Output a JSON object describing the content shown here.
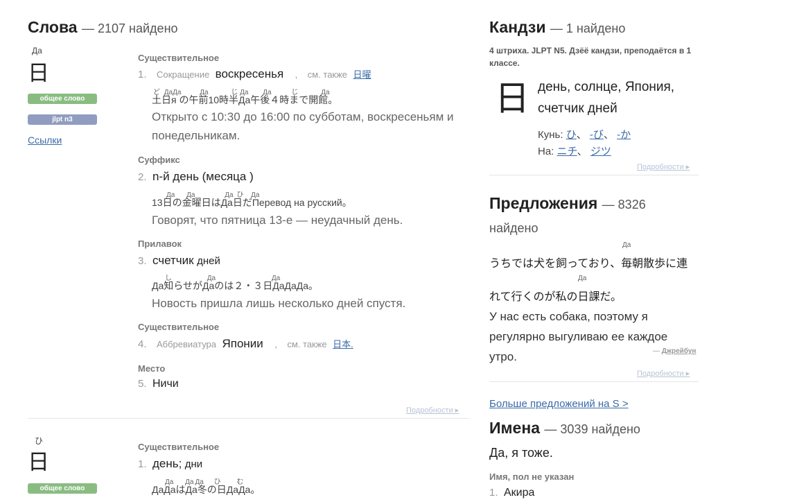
{
  "words": {
    "title": "Слова",
    "count": "— 2107 найдено",
    "entries": [
      {
        "reading": "Да",
        "kanji": "日",
        "tags": [
          "общее слово",
          "jlpt n3"
        ],
        "links_label": "Ссылки",
        "details_label": "Подробности ▸",
        "senses": [
          {
            "pos": "Существительное",
            "num": "1.",
            "prefix": "Сокращение",
            "meaning": "воскресенья",
            "comma": ",",
            "see_also": "см. также",
            "see_link": "日曜",
            "sentence_ja": "土日я の午前10時半Да午後４時まで開館。",
            "sentence_furi": [
              "ど",
              "Да",
              "Да",
              "Да",
              "じ",
              "Да",
              "Да",
              "じ",
              "Да"
            ],
            "sentence_en": "Открыто с 10:30 до 16:00 по субботам, воскресеньям и понедельникам."
          },
          {
            "pos": "Суффикс",
            "num": "2.",
            "meaning": "n-й день (месяца )",
            "sentence_ja": "13日の金曜日はДа日だПеревод на русский。",
            "sentence_furi": [
              "Да",
              "Да",
              "Да",
              "ひ",
              "Да"
            ],
            "sentence_en": "Говорят, что пятница 13-е — неудачный день."
          },
          {
            "pos": "Прилавок",
            "num": "3.",
            "meaning": "счетчик",
            "meaning_small": "дней",
            "sentence_ja": "Да知らせがДаのは２・３日ДаДаДа。",
            "sentence_furi": [
              "し",
              "Да",
              "Да"
            ],
            "sentence_en": "Новость пришла лишь несколько дней спустя."
          },
          {
            "pos": "Существительное",
            "num": "4.",
            "prefix": "Аббревиатура",
            "meaning": "Японии",
            "comma": ",",
            "see_also": "см. также",
            "see_link": "日本."
          },
          {
            "pos": "Место",
            "num": "5.",
            "meaning": "Ничи"
          }
        ]
      },
      {
        "reading": "ひ",
        "kanji": "日",
        "tags": [
          "общее слово"
        ],
        "senses": [
          {
            "pos": "Существительное",
            "num": "1.",
            "meaning": "день;",
            "meaning_small": "дни",
            "sentence_ja": "ДаДаはДа冬の日ДаДа。",
            "sentence_furi": [
              "Да",
              "Да",
              "Да",
              "ひ",
              "む"
            ]
          }
        ]
      }
    ]
  },
  "kanji": {
    "title": "Кандзи",
    "count": "— 1 найдено",
    "info": "4 штриха. JLPT N5. Дзёё кандзи, преподаётся в 1 классе.",
    "char": "日",
    "meaning": "день, солнце, Япония, счетчик дней",
    "kun_label": "Кунь:",
    "kun": [
      "ひ",
      "-び",
      "-か"
    ],
    "on_label": "На:",
    "on": [
      "ニチ",
      "ジツ"
    ],
    "sep": "、",
    "details_label": "Подробности ▸"
  },
  "sentences": {
    "title": "Предложения",
    "count": "— 8326 найдено",
    "ja_line1": "うちでは犬を飼っており、毎朝散歩に連",
    "ja_line2": "れて行くのが私の日課だ。",
    "furi1": "Да",
    "furi2": "Да",
    "en": "У нас есть собака, поэтому я регулярно выгуливаю ее каждое утро.",
    "attribution_dash": "—",
    "attribution": "Джрейбун",
    "details_label": "Подробности ▸",
    "more_link": "Больше предложений на S >"
  },
  "names": {
    "title": "Имена",
    "count": "— 3039 найдено",
    "entry": "Да, я тоже.",
    "pos": "Имя, пол не указан",
    "num": "1.",
    "name": "Акира"
  }
}
